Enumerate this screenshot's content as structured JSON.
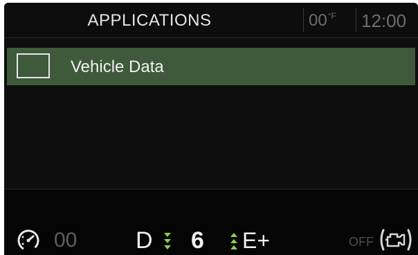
{
  "header": {
    "title": "APPLICATIONS",
    "temperature": "00",
    "temperature_unit": "°F",
    "clock": "12:00"
  },
  "apps": [
    {
      "label": "Vehicle Data",
      "icon": "app-square-icon",
      "selected": true
    }
  ],
  "status": {
    "speed": "00",
    "gear_mode": "D",
    "gear_number": "6",
    "drive_mode": "E+",
    "engine_state": "OFF",
    "speed_icon": "speedometer-icon",
    "engine_icon": "check-engine-icon",
    "shift_arrows_icon": "shift-arrows-icon"
  },
  "colors": {
    "selected_row": "#3e5a3b",
    "shift_arrow": "#8fd14a",
    "dim_text": "#6e6e6e"
  }
}
